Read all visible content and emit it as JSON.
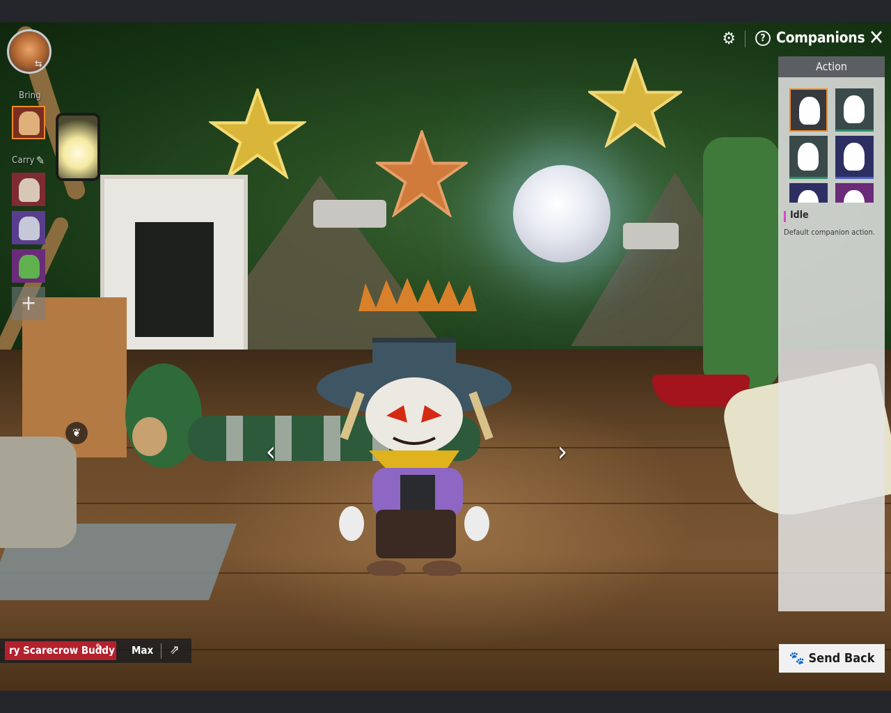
{
  "header": {
    "title": "Companions",
    "settings_icon": "gear-icon",
    "help_icon": "help-circle-icon",
    "close_icon": "close-icon"
  },
  "left_panel": {
    "bring_label": "Bring",
    "carry_label": "Carry",
    "add_icon": "plus-icon",
    "add_symbol": "+"
  },
  "action_panel": {
    "heading": "Action",
    "selected_action": "Idle",
    "description": "Default companion action."
  },
  "companion": {
    "name": "ry Scarecrow Buddy",
    "level": "Max"
  },
  "buttons": {
    "send_back": "Send Back",
    "send_back_icon": "paw-icon"
  },
  "navigation": {
    "prev_symbol": "‹",
    "next_symbol": "›"
  },
  "colors": {
    "accent_orange": "#f08a2a",
    "name_red": "#b3212d",
    "idle_marker": "#d24cc6"
  }
}
